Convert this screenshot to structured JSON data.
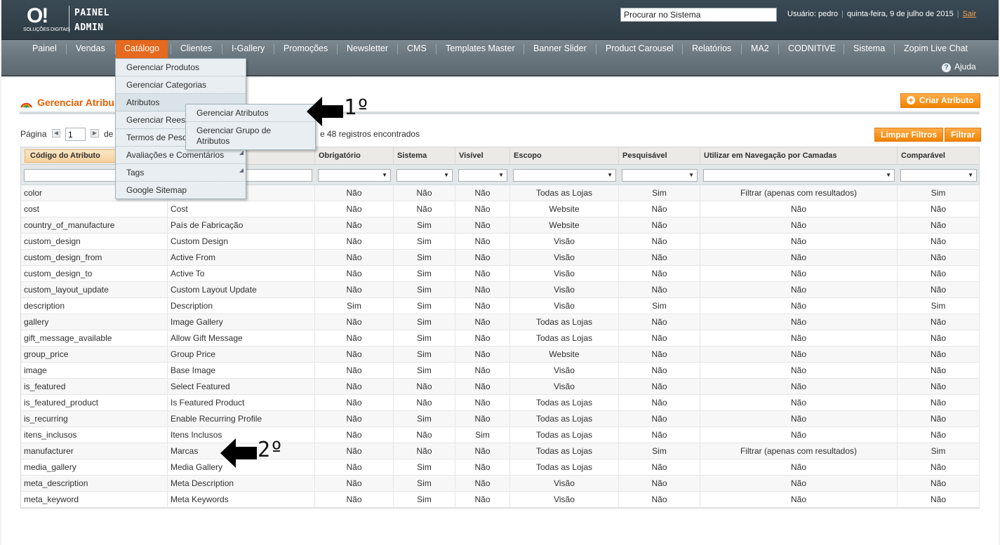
{
  "header": {
    "logo_mark": "O!",
    "logo_sub": "SOLUÇÕES DIGITAIS",
    "logo_line1": "PAINEL",
    "logo_line2": "ADMIN",
    "search_value": "Procurar no Sistema",
    "user": "Usuário: pedro",
    "date": "quinta-feira, 9 de julho de 2015",
    "logout": "Sair"
  },
  "nav": {
    "items": [
      "Painel",
      "Vendas",
      "Catálogo",
      "Clientes",
      "I-Gallery",
      "Promoções",
      "Newsletter",
      "CMS",
      "Templates Master",
      "Banner Slider",
      "Product Carousel",
      "Relatórios",
      "MA2",
      "CODNITIVE",
      "Sistema",
      "Zopim Live Chat"
    ],
    "active": "Catálogo",
    "help": "Ajuda"
  },
  "catalog_menu": {
    "items": [
      "Gerenciar Produtos",
      "Gerenciar Categorias",
      "Atributos",
      "Gerenciar Rees",
      "Termos de Pesq",
      "Avaliações e Comentários",
      "Tags",
      "Google Sitemap"
    ],
    "sub_items": [
      "Gerenciar Atributos",
      "Gerenciar Grupo de Atributos"
    ]
  },
  "annotations": {
    "first": "1º",
    "second": "2º"
  },
  "page": {
    "title": "Gerenciar Atribu",
    "create_button": "Criar Atributo",
    "pager_label": "Página",
    "pager_value": "1",
    "pager_of": "de",
    "records": "e 48 registros encontrados",
    "reset_button": "Limpar Filtros",
    "filter_button": "Filtrar"
  },
  "grid": {
    "columns": [
      "Código do Atributo",
      "",
      "Obrigatório",
      "Sistema",
      "Visível",
      "Escopo",
      "Pesquisável",
      "Utilizar em Navegação por Camadas",
      "Comparável"
    ],
    "rows": [
      [
        "color",
        "",
        "Não",
        "Não",
        "Não",
        "Todas as Lojas",
        "Sim",
        "Filtrar (apenas com resultados)",
        "Sim"
      ],
      [
        "cost",
        "Cost",
        "Não",
        "Não",
        "Não",
        "Website",
        "Não",
        "Não",
        "Não"
      ],
      [
        "country_of_manufacture",
        "País de Fabricação",
        "Não",
        "Sim",
        "Não",
        "Website",
        "Não",
        "Não",
        "Não"
      ],
      [
        "custom_design",
        "Custom Design",
        "Não",
        "Sim",
        "Não",
        "Visão",
        "Não",
        "Não",
        "Não"
      ],
      [
        "custom_design_from",
        "Active From",
        "Não",
        "Sim",
        "Não",
        "Visão",
        "Não",
        "Não",
        "Não"
      ],
      [
        "custom_design_to",
        "Active To",
        "Não",
        "Sim",
        "Não",
        "Visão",
        "Não",
        "Não",
        "Não"
      ],
      [
        "custom_layout_update",
        "Custom Layout Update",
        "Não",
        "Sim",
        "Não",
        "Visão",
        "Não",
        "Não",
        "Não"
      ],
      [
        "description",
        "Description",
        "Sim",
        "Sim",
        "Não",
        "Visão",
        "Sim",
        "Não",
        "Sim"
      ],
      [
        "gallery",
        "Image Gallery",
        "Não",
        "Sim",
        "Não",
        "Todas as Lojas",
        "Não",
        "Não",
        "Não"
      ],
      [
        "gift_message_available",
        "Allow Gift Message",
        "Não",
        "Sim",
        "Não",
        "Todas as Lojas",
        "Não",
        "Não",
        "Não"
      ],
      [
        "group_price",
        "Group Price",
        "Não",
        "Sim",
        "Não",
        "Website",
        "Não",
        "Não",
        "Não"
      ],
      [
        "image",
        "Base Image",
        "Não",
        "Sim",
        "Não",
        "Visão",
        "Não",
        "Não",
        "Não"
      ],
      [
        "is_featured",
        "Select Featured",
        "Não",
        "Não",
        "Não",
        "Visão",
        "Não",
        "Não",
        "Não"
      ],
      [
        "is_featured_product",
        "Is Featured Product",
        "Não",
        "Não",
        "Não",
        "Todas as Lojas",
        "Não",
        "Não",
        "Não"
      ],
      [
        "is_recurring",
        "Enable Recurring Profile",
        "Não",
        "Sim",
        "Não",
        "Todas as Lojas",
        "Não",
        "Não",
        "Não"
      ],
      [
        "itens_inclusos",
        "Itens Inclusos",
        "Não",
        "Não",
        "Sim",
        "Todas as Lojas",
        "Não",
        "Não",
        "Não"
      ],
      [
        "manufacturer",
        "Marcas",
        "Não",
        "Não",
        "Não",
        "Todas as Lojas",
        "Sim",
        "Filtrar (apenas com resultados)",
        "Sim"
      ],
      [
        "media_gallery",
        "Media Gallery",
        "Não",
        "Sim",
        "Não",
        "Todas as Lojas",
        "Não",
        "Não",
        "Não"
      ],
      [
        "meta_description",
        "Meta Description",
        "Não",
        "Sim",
        "Não",
        "Visão",
        "Não",
        "Não",
        "Não"
      ],
      [
        "meta_keyword",
        "Meta Keywords",
        "Não",
        "Sim",
        "Não",
        "Visão",
        "Não",
        "Não",
        "Não"
      ]
    ]
  }
}
